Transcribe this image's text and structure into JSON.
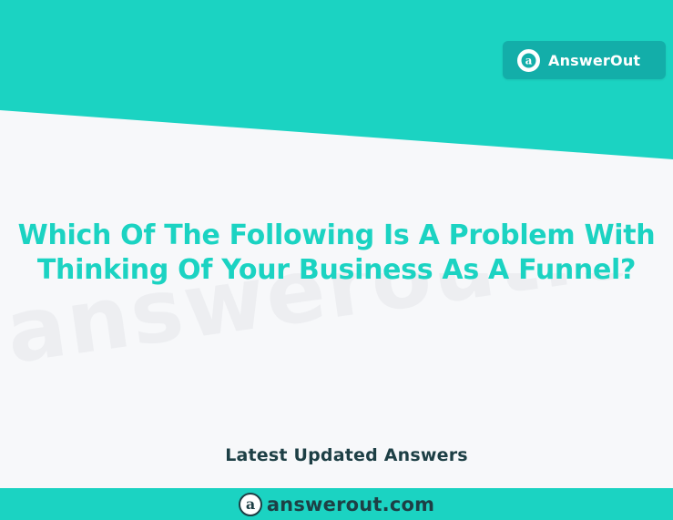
{
  "brand": {
    "name": "AnswerOut",
    "logo_glyph": "a",
    "logo_icon": "at-sign-logo-icon"
  },
  "headline": {
    "line1": "Which Of The Following Is A Problem With",
    "line2": "Thinking Of Your Business As A Funnel?"
  },
  "latest_label": "Latest Updated Answers",
  "footer": {
    "domain": "answerout.com",
    "logo_glyph": "a"
  },
  "watermark": "answerout.com",
  "colors": {
    "teal": "#1bd3c2",
    "badge": "#13aea9",
    "dark_text": "#1d3f45",
    "background": "#f7f8fa"
  }
}
